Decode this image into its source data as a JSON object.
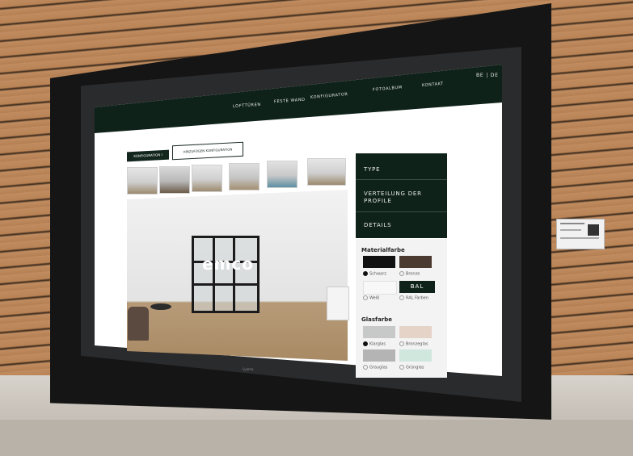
{
  "nav": {
    "items": [
      "LOFTTÜREN",
      "FESTE WAND",
      "KONFIGURATOR",
      "FOTOALBUM",
      "KONTAKT"
    ],
    "lang": "BE | DE"
  },
  "config": {
    "tab_active": "KONFIGURATION I",
    "tab_other": "HINZUFÜGEN KONFIGURATION"
  },
  "room": {
    "logo": "emco"
  },
  "panel": {
    "items": [
      "TYPE",
      "VERTEILUNG DER PROFILE",
      "DETAILS"
    ]
  },
  "options": {
    "material_heading": "Materialfarbe",
    "material": [
      {
        "label": "Schwarz",
        "color": "#111111",
        "selected": true
      },
      {
        "label": "Bronze",
        "color": "#4a3a30",
        "selected": false
      },
      {
        "label": "Weiß",
        "color": "#f8f8f8",
        "selected": false
      },
      {
        "label": "RAL Farben",
        "color": "#0f2219",
        "selected": false
      }
    ],
    "bal_label": "BAL",
    "glass_heading": "Glasfarbe",
    "glass": [
      {
        "label": "Klarglas",
        "color": "#c7c9c9",
        "selected": true
      },
      {
        "label": "Bronzeglas",
        "color": "#e6d3c8",
        "selected": false
      },
      {
        "label": "Grauglas",
        "color": "#b4b4b4",
        "selected": false
      },
      {
        "label": "Grünglas",
        "color": "#cfe7dc",
        "selected": false
      }
    ]
  },
  "tv_brand": "iiyama",
  "colors": {
    "accent": "#0f2219",
    "wood": "#b9855a"
  }
}
